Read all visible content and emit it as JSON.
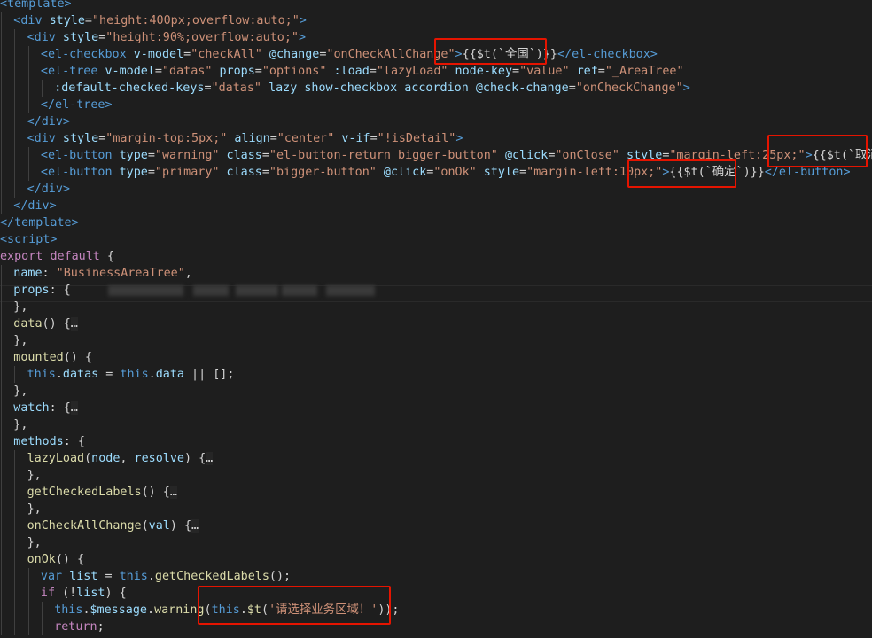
{
  "colors": {
    "tag": "#569cd6",
    "element": "#569cd6",
    "attr": "#9cdcfe",
    "string": "#ce9178",
    "plain": "#d4d4d4",
    "keyword": "#c586c0",
    "function": "#dcdcaa",
    "this": "#569cd6",
    "property": "#9cdcfe",
    "highlight": "#e51400"
  },
  "lines": [
    {
      "indent": 0,
      "tokens": [
        {
          "t": "<template>",
          "c": "tag"
        }
      ]
    },
    {
      "indent": 1,
      "tokens": [
        {
          "t": "<div ",
          "c": "tag"
        },
        {
          "t": "style",
          "c": "attr"
        },
        {
          "t": "=",
          "c": "plain"
        },
        {
          "t": "\"height:400px;overflow:auto;\"",
          "c": "string"
        },
        {
          "t": ">",
          "c": "tag"
        }
      ]
    },
    {
      "indent": 2,
      "tokens": [
        {
          "t": "<div ",
          "c": "tag"
        },
        {
          "t": "style",
          "c": "attr"
        },
        {
          "t": "=",
          "c": "plain"
        },
        {
          "t": "\"height:90%;overflow:auto;\"",
          "c": "string"
        },
        {
          "t": ">",
          "c": "tag"
        }
      ]
    },
    {
      "indent": 3,
      "tokens": [
        {
          "t": "<el-checkbox ",
          "c": "tag"
        },
        {
          "t": "v-model",
          "c": "attr"
        },
        {
          "t": "=",
          "c": "plain"
        },
        {
          "t": "\"checkAll\"",
          "c": "string"
        },
        {
          "t": " ",
          "c": "plain"
        },
        {
          "t": "@change",
          "c": "attr"
        },
        {
          "t": "=",
          "c": "plain"
        },
        {
          "t": "\"onCheckAllChange\"",
          "c": "string"
        },
        {
          "t": ">",
          "c": "tag"
        },
        {
          "t": "{{$t(`全国`)}}",
          "c": "plain"
        },
        {
          "t": "</el-checkbox>",
          "c": "tag"
        }
      ]
    },
    {
      "indent": 3,
      "tokens": [
        {
          "t": "<el-tree ",
          "c": "tag"
        },
        {
          "t": "v-model",
          "c": "attr"
        },
        {
          "t": "=",
          "c": "plain"
        },
        {
          "t": "\"datas\"",
          "c": "string"
        },
        {
          "t": " ",
          "c": "plain"
        },
        {
          "t": "props",
          "c": "attr"
        },
        {
          "t": "=",
          "c": "plain"
        },
        {
          "t": "\"options\"",
          "c": "string"
        },
        {
          "t": " ",
          "c": "plain"
        },
        {
          "t": ":load",
          "c": "attr"
        },
        {
          "t": "=",
          "c": "plain"
        },
        {
          "t": "\"lazyLoad\"",
          "c": "string"
        },
        {
          "t": " ",
          "c": "plain"
        },
        {
          "t": "node-key",
          "c": "attr"
        },
        {
          "t": "=",
          "c": "plain"
        },
        {
          "t": "\"value\"",
          "c": "string"
        },
        {
          "t": " ",
          "c": "plain"
        },
        {
          "t": "ref",
          "c": "attr"
        },
        {
          "t": "=",
          "c": "plain"
        },
        {
          "t": "\"_AreaTree\"",
          "c": "string"
        }
      ]
    },
    {
      "indent": 4,
      "tokens": [
        {
          "t": ":default-checked-keys",
          "c": "attr"
        },
        {
          "t": "=",
          "c": "plain"
        },
        {
          "t": "\"datas\"",
          "c": "string"
        },
        {
          "t": " ",
          "c": "plain"
        },
        {
          "t": "lazy",
          "c": "attr"
        },
        {
          "t": " ",
          "c": "plain"
        },
        {
          "t": "show-checkbox",
          "c": "attr"
        },
        {
          "t": " ",
          "c": "plain"
        },
        {
          "t": "accordion",
          "c": "attr"
        },
        {
          "t": " ",
          "c": "plain"
        },
        {
          "t": "@check-change",
          "c": "attr"
        },
        {
          "t": "=",
          "c": "plain"
        },
        {
          "t": "\"onCheckChange\"",
          "c": "string"
        },
        {
          "t": ">",
          "c": "tag"
        }
      ]
    },
    {
      "indent": 3,
      "tokens": [
        {
          "t": "</el-tree>",
          "c": "tag"
        }
      ]
    },
    {
      "indent": 2,
      "tokens": [
        {
          "t": "</div>",
          "c": "tag"
        }
      ]
    },
    {
      "indent": 2,
      "tokens": [
        {
          "t": "<div ",
          "c": "tag"
        },
        {
          "t": "style",
          "c": "attr"
        },
        {
          "t": "=",
          "c": "plain"
        },
        {
          "t": "\"margin-top:5px;\"",
          "c": "string"
        },
        {
          "t": " ",
          "c": "plain"
        },
        {
          "t": "align",
          "c": "attr"
        },
        {
          "t": "=",
          "c": "plain"
        },
        {
          "t": "\"center\"",
          "c": "string"
        },
        {
          "t": " ",
          "c": "plain"
        },
        {
          "t": "v-if",
          "c": "attr"
        },
        {
          "t": "=",
          "c": "plain"
        },
        {
          "t": "\"!isDetail\"",
          "c": "string"
        },
        {
          "t": ">",
          "c": "tag"
        }
      ]
    },
    {
      "indent": 3,
      "tokens": [
        {
          "t": "<el-button ",
          "c": "tag"
        },
        {
          "t": "type",
          "c": "attr"
        },
        {
          "t": "=",
          "c": "plain"
        },
        {
          "t": "\"warning\"",
          "c": "string"
        },
        {
          "t": " ",
          "c": "plain"
        },
        {
          "t": "class",
          "c": "attr"
        },
        {
          "t": "=",
          "c": "plain"
        },
        {
          "t": "\"el-button-return bigger-button\"",
          "c": "string"
        },
        {
          "t": " ",
          "c": "plain"
        },
        {
          "t": "@click",
          "c": "attr"
        },
        {
          "t": "=",
          "c": "plain"
        },
        {
          "t": "\"onClose\"",
          "c": "string"
        },
        {
          "t": " ",
          "c": "plain"
        },
        {
          "t": "style",
          "c": "attr"
        },
        {
          "t": "=",
          "c": "plain"
        },
        {
          "t": "\"margin-left:25px;\"",
          "c": "string"
        },
        {
          "t": ">",
          "c": "tag"
        },
        {
          "t": "{{$t(`取消`)}}",
          "c": "plain"
        }
      ]
    },
    {
      "indent": 3,
      "tokens": [
        {
          "t": "<el-button ",
          "c": "tag"
        },
        {
          "t": "type",
          "c": "attr"
        },
        {
          "t": "=",
          "c": "plain"
        },
        {
          "t": "\"primary\"",
          "c": "string"
        },
        {
          "t": " ",
          "c": "plain"
        },
        {
          "t": "class",
          "c": "attr"
        },
        {
          "t": "=",
          "c": "plain"
        },
        {
          "t": "\"bigger-button\"",
          "c": "string"
        },
        {
          "t": " ",
          "c": "plain"
        },
        {
          "t": "@click",
          "c": "attr"
        },
        {
          "t": "=",
          "c": "plain"
        },
        {
          "t": "\"onOk\"",
          "c": "string"
        },
        {
          "t": " ",
          "c": "plain"
        },
        {
          "t": "style",
          "c": "attr"
        },
        {
          "t": "=",
          "c": "plain"
        },
        {
          "t": "\"margin-left:10px;\"",
          "c": "string"
        },
        {
          "t": ">",
          "c": "tag"
        },
        {
          "t": "{{$t(`确定`)}}",
          "c": "plain"
        },
        {
          "t": "</el-button>",
          "c": "tag"
        }
      ]
    },
    {
      "indent": 2,
      "tokens": [
        {
          "t": "</div>",
          "c": "tag"
        }
      ]
    },
    {
      "indent": 1,
      "tokens": [
        {
          "t": "</div>",
          "c": "tag"
        }
      ]
    },
    {
      "indent": 0,
      "tokens": [
        {
          "t": "</template>",
          "c": "tag"
        }
      ]
    },
    {
      "indent": 0,
      "tokens": [
        {
          "t": "<script>",
          "c": "tag"
        }
      ]
    },
    {
      "indent": 0,
      "tokens": [
        {
          "t": "export",
          "c": "keyword"
        },
        {
          "t": " ",
          "c": "plain"
        },
        {
          "t": "default",
          "c": "keyword"
        },
        {
          "t": " {",
          "c": "plain"
        }
      ]
    },
    {
      "indent": 1,
      "tokens": [
        {
          "t": "name",
          "c": "property"
        },
        {
          "t": ": ",
          "c": "plain"
        },
        {
          "t": "\"BusinessAreaTree\"",
          "c": "string"
        },
        {
          "t": ",",
          "c": "plain"
        }
      ]
    },
    {
      "indent": 1,
      "tokens": [
        {
          "t": "props",
          "c": "property"
        },
        {
          "t": ": {",
          "c": "plain"
        }
      ]
    },
    {
      "indent": 1,
      "tokens": [
        {
          "t": "},",
          "c": "plain"
        }
      ]
    },
    {
      "indent": 1,
      "tokens": [
        {
          "t": "data",
          "c": "function"
        },
        {
          "t": "() {",
          "c": "plain"
        },
        {
          "t": "…",
          "c": "fold"
        }
      ]
    },
    {
      "indent": 1,
      "tokens": [
        {
          "t": "},",
          "c": "plain"
        }
      ]
    },
    {
      "indent": 1,
      "tokens": [
        {
          "t": "mounted",
          "c": "function"
        },
        {
          "t": "() {",
          "c": "plain"
        }
      ]
    },
    {
      "indent": 2,
      "tokens": [
        {
          "t": "this",
          "c": "this"
        },
        {
          "t": ".",
          "c": "plain"
        },
        {
          "t": "datas",
          "c": "property"
        },
        {
          "t": " = ",
          "c": "plain"
        },
        {
          "t": "this",
          "c": "this"
        },
        {
          "t": ".",
          "c": "plain"
        },
        {
          "t": "data",
          "c": "property"
        },
        {
          "t": " || [];",
          "c": "plain"
        }
      ]
    },
    {
      "indent": 1,
      "tokens": [
        {
          "t": "},",
          "c": "plain"
        }
      ]
    },
    {
      "indent": 1,
      "tokens": [
        {
          "t": "watch",
          "c": "property"
        },
        {
          "t": ": {",
          "c": "plain"
        },
        {
          "t": "…",
          "c": "fold"
        }
      ]
    },
    {
      "indent": 1,
      "tokens": [
        {
          "t": "},",
          "c": "plain"
        }
      ]
    },
    {
      "indent": 1,
      "tokens": [
        {
          "t": "methods",
          "c": "property"
        },
        {
          "t": ": {",
          "c": "plain"
        }
      ]
    },
    {
      "indent": 2,
      "tokens": [
        {
          "t": "lazyLoad",
          "c": "function"
        },
        {
          "t": "(",
          "c": "plain"
        },
        {
          "t": "node",
          "c": "property"
        },
        {
          "t": ", ",
          "c": "plain"
        },
        {
          "t": "resolve",
          "c": "property"
        },
        {
          "t": ") {",
          "c": "plain"
        },
        {
          "t": "…",
          "c": "fold"
        }
      ]
    },
    {
      "indent": 2,
      "tokens": [
        {
          "t": "},",
          "c": "plain"
        }
      ]
    },
    {
      "indent": 2,
      "tokens": [
        {
          "t": "getCheckedLabels",
          "c": "function"
        },
        {
          "t": "() {",
          "c": "plain"
        },
        {
          "t": "…",
          "c": "fold"
        }
      ]
    },
    {
      "indent": 2,
      "tokens": [
        {
          "t": "},",
          "c": "plain"
        }
      ]
    },
    {
      "indent": 2,
      "tokens": [
        {
          "t": "onCheckAllChange",
          "c": "function"
        },
        {
          "t": "(",
          "c": "plain"
        },
        {
          "t": "val",
          "c": "property"
        },
        {
          "t": ") {",
          "c": "plain"
        },
        {
          "t": "…",
          "c": "fold"
        }
      ]
    },
    {
      "indent": 2,
      "tokens": [
        {
          "t": "},",
          "c": "plain"
        }
      ]
    },
    {
      "indent": 2,
      "tokens": [
        {
          "t": "onOk",
          "c": "function"
        },
        {
          "t": "() {",
          "c": "plain"
        }
      ]
    },
    {
      "indent": 3,
      "tokens": [
        {
          "t": "var",
          "c": "this"
        },
        {
          "t": " ",
          "c": "plain"
        },
        {
          "t": "list",
          "c": "property"
        },
        {
          "t": " = ",
          "c": "plain"
        },
        {
          "t": "this",
          "c": "this"
        },
        {
          "t": ".",
          "c": "plain"
        },
        {
          "t": "getCheckedLabels",
          "c": "function"
        },
        {
          "t": "();",
          "c": "plain"
        }
      ]
    },
    {
      "indent": 3,
      "tokens": [
        {
          "t": "if",
          "c": "keyword"
        },
        {
          "t": " (!",
          "c": "plain"
        },
        {
          "t": "list",
          "c": "property"
        },
        {
          "t": ") {",
          "c": "plain"
        }
      ]
    },
    {
      "indent": 4,
      "tokens": [
        {
          "t": "this",
          "c": "this"
        },
        {
          "t": ".",
          "c": "plain"
        },
        {
          "t": "$message",
          "c": "property"
        },
        {
          "t": ".",
          "c": "plain"
        },
        {
          "t": "warning",
          "c": "function"
        },
        {
          "t": "(",
          "c": "plain"
        },
        {
          "t": "this",
          "c": "this"
        },
        {
          "t": ".",
          "c": "plain"
        },
        {
          "t": "$t",
          "c": "function"
        },
        {
          "t": "(",
          "c": "plain"
        },
        {
          "t": "'请选择业务区域！'",
          "c": "string"
        },
        {
          "t": "));",
          "c": "plain"
        }
      ]
    },
    {
      "indent": 4,
      "tokens": [
        {
          "t": "return",
          "c": "keyword"
        },
        {
          "t": ";",
          "c": "plain"
        }
      ]
    }
  ]
}
